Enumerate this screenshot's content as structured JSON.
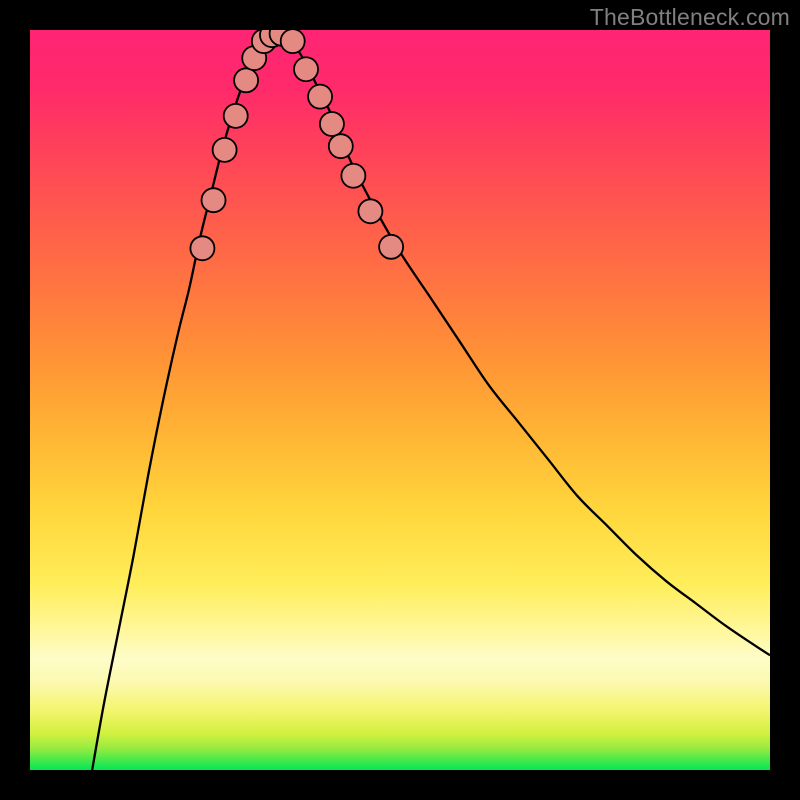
{
  "watermark": "TheBottleneck.com",
  "colors": {
    "curve_stroke": "#000000",
    "marker_fill": "#e58a82",
    "marker_stroke": "#000000",
    "background_frame": "#000000"
  },
  "chart_data": {
    "type": "line",
    "title": "",
    "xlabel": "",
    "ylabel": "",
    "xlim": [
      0,
      1
    ],
    "ylim": [
      0,
      1
    ],
    "curves": [
      {
        "name": "left-curve",
        "points": [
          {
            "x": 0.084,
            "y": 0.0
          },
          {
            "x": 0.1,
            "y": 0.09
          },
          {
            "x": 0.12,
            "y": 0.19
          },
          {
            "x": 0.14,
            "y": 0.29
          },
          {
            "x": 0.16,
            "y": 0.4
          },
          {
            "x": 0.18,
            "y": 0.5
          },
          {
            "x": 0.2,
            "y": 0.59
          },
          {
            "x": 0.215,
            "y": 0.65
          },
          {
            "x": 0.23,
            "y": 0.72
          },
          {
            "x": 0.245,
            "y": 0.78
          },
          {
            "x": 0.26,
            "y": 0.84
          },
          {
            "x": 0.275,
            "y": 0.89
          },
          {
            "x": 0.285,
            "y": 0.92
          },
          {
            "x": 0.295,
            "y": 0.95
          },
          {
            "x": 0.305,
            "y": 0.975
          },
          {
            "x": 0.32,
            "y": 0.99
          }
        ]
      },
      {
        "name": "right-curve",
        "points": [
          {
            "x": 0.35,
            "y": 0.99
          },
          {
            "x": 0.37,
            "y": 0.96
          },
          {
            "x": 0.39,
            "y": 0.92
          },
          {
            "x": 0.41,
            "y": 0.88
          },
          {
            "x": 0.43,
            "y": 0.83
          },
          {
            "x": 0.46,
            "y": 0.77
          },
          {
            "x": 0.5,
            "y": 0.7
          },
          {
            "x": 0.54,
            "y": 0.64
          },
          {
            "x": 0.58,
            "y": 0.58
          },
          {
            "x": 0.62,
            "y": 0.52
          },
          {
            "x": 0.66,
            "y": 0.47
          },
          {
            "x": 0.7,
            "y": 0.42
          },
          {
            "x": 0.74,
            "y": 0.37
          },
          {
            "x": 0.78,
            "y": 0.33
          },
          {
            "x": 0.82,
            "y": 0.29
          },
          {
            "x": 0.86,
            "y": 0.255
          },
          {
            "x": 0.9,
            "y": 0.225
          },
          {
            "x": 0.94,
            "y": 0.195
          },
          {
            "x": 0.98,
            "y": 0.168
          },
          {
            "x": 1.0,
            "y": 0.155
          }
        ]
      }
    ],
    "markers": [
      {
        "x": 0.233,
        "y": 0.705
      },
      {
        "x": 0.248,
        "y": 0.77
      },
      {
        "x": 0.263,
        "y": 0.838
      },
      {
        "x": 0.278,
        "y": 0.884
      },
      {
        "x": 0.292,
        "y": 0.932
      },
      {
        "x": 0.303,
        "y": 0.962
      },
      {
        "x": 0.316,
        "y": 0.985
      },
      {
        "x": 0.327,
        "y": 0.993
      },
      {
        "x": 0.34,
        "y": 0.995
      },
      {
        "x": 0.355,
        "y": 0.985
      },
      {
        "x": 0.373,
        "y": 0.947
      },
      {
        "x": 0.392,
        "y": 0.91
      },
      {
        "x": 0.408,
        "y": 0.873
      },
      {
        "x": 0.42,
        "y": 0.843
      },
      {
        "x": 0.437,
        "y": 0.803
      },
      {
        "x": 0.46,
        "y": 0.755
      },
      {
        "x": 0.488,
        "y": 0.707
      }
    ],
    "marker_radius_px": 12
  }
}
